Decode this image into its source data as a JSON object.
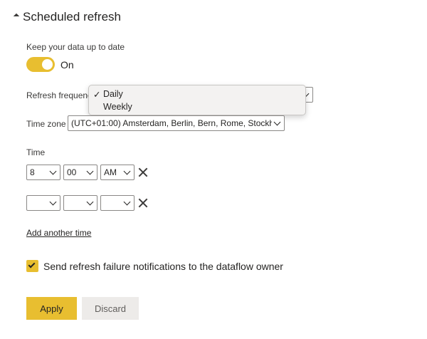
{
  "section": {
    "title": "Scheduled refresh",
    "caret_icon": "caret-down-icon"
  },
  "keep_up_to_date": {
    "label": "Keep your data up to date",
    "toggle_text": "On",
    "toggle_color": "#e8be30"
  },
  "refresh_frequency": {
    "label": "Refresh frequenc",
    "selected": "",
    "options": [
      {
        "check": "✓",
        "label": "Daily",
        "selected": true
      },
      {
        "check": "",
        "label": "Weekly",
        "selected": false
      }
    ]
  },
  "time_zone": {
    "label": "Time zone",
    "value": "(UTC+01:00) Amsterdam, Berlin, Bern, Rome, Stockho"
  },
  "time": {
    "label": "Time",
    "rows": [
      {
        "hour": "8",
        "minute": "00",
        "ampm": "AM"
      },
      {
        "hour": "",
        "minute": "",
        "ampm": ""
      }
    ],
    "remove_icon": "close-icon"
  },
  "add_time_link": "Add another time",
  "notification": {
    "label": "Send refresh failure notifications to the dataflow owner",
    "checked": true
  },
  "buttons": {
    "apply": "Apply",
    "discard": "Discard"
  },
  "colors": {
    "accent": "#e8be30",
    "discard_bg": "#edebe9"
  }
}
